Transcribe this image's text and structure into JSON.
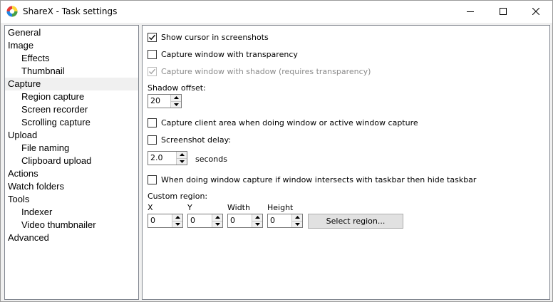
{
  "window": {
    "title": "ShareX - Task settings",
    "colors": {
      "title_bg": "#ffffff",
      "panel_bg": "#ffffff",
      "selected_bg": "#f0f0f0",
      "disabled_text": "#8a8a8a"
    }
  },
  "titlebar": {
    "minimize_icon": "minimize-icon",
    "maximize_icon": "maximize-icon",
    "close_icon": "close-icon"
  },
  "tree": {
    "items": [
      {
        "label": "General",
        "level": 0
      },
      {
        "label": "Image",
        "level": 0
      },
      {
        "label": "Effects",
        "level": 1
      },
      {
        "label": "Thumbnail",
        "level": 1
      },
      {
        "label": "Capture",
        "level": 0,
        "selected": true
      },
      {
        "label": "Region capture",
        "level": 1
      },
      {
        "label": "Screen recorder",
        "level": 1
      },
      {
        "label": "Scrolling capture",
        "level": 1
      },
      {
        "label": "Upload",
        "level": 0
      },
      {
        "label": "File naming",
        "level": 1
      },
      {
        "label": "Clipboard upload",
        "level": 1
      },
      {
        "label": "Actions",
        "level": 0
      },
      {
        "label": "Watch folders",
        "level": 0
      },
      {
        "label": "Tools",
        "level": 0
      },
      {
        "label": "Indexer",
        "level": 1
      },
      {
        "label": "Video thumbnailer",
        "level": 1
      },
      {
        "label": "Advanced",
        "level": 0
      }
    ]
  },
  "capture": {
    "show_cursor": {
      "label": "Show cursor in screenshots",
      "checked": true
    },
    "transparency": {
      "label": "Capture window with transparency",
      "checked": false
    },
    "shadow": {
      "label": "Capture window with shadow (requires transparency)",
      "checked": true,
      "disabled": true
    },
    "shadow_offset": {
      "label": "Shadow offset:",
      "value": "20"
    },
    "client_area": {
      "label": "Capture client area when doing window or active window capture",
      "checked": false
    },
    "screenshot_delay": {
      "label": "Screenshot delay:",
      "checked": false,
      "value": "2.0",
      "unit": "seconds"
    },
    "hide_taskbar": {
      "label": "When doing window capture if window intersects with taskbar then hide taskbar",
      "checked": false
    },
    "custom_region": {
      "label": "Custom region:",
      "x_label": "X",
      "x_value": "0",
      "y_label": "Y",
      "y_value": "0",
      "width_label": "Width",
      "width_value": "0",
      "height_label": "Height",
      "height_value": "0",
      "select_button": "Select region..."
    }
  }
}
